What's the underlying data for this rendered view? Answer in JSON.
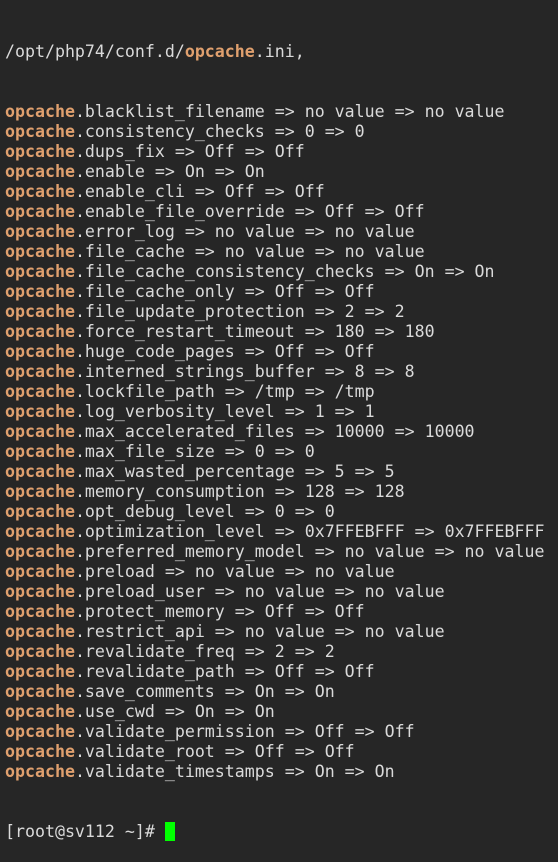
{
  "terminal": {
    "header": {
      "prefix": "/opt/php74/conf.d/",
      "keyword": "opcache",
      "suffix": ".ini,"
    },
    "keyword": "opcache",
    "settings": [
      ".blacklist_filename => no value => no value",
      ".consistency_checks => 0 => 0",
      ".dups_fix => Off => Off",
      ".enable => On => On",
      ".enable_cli => Off => Off",
      ".enable_file_override => Off => Off",
      ".error_log => no value => no value",
      ".file_cache => no value => no value",
      ".file_cache_consistency_checks => On => On",
      ".file_cache_only => Off => Off",
      ".file_update_protection => 2 => 2",
      ".force_restart_timeout => 180 => 180",
      ".huge_code_pages => Off => Off",
      ".interned_strings_buffer => 8 => 8",
      ".lockfile_path => /tmp => /tmp",
      ".log_verbosity_level => 1 => 1",
      ".max_accelerated_files => 10000 => 10000",
      ".max_file_size => 0 => 0",
      ".max_wasted_percentage => 5 => 5",
      ".memory_consumption => 128 => 128",
      ".opt_debug_level => 0 => 0",
      ".optimization_level => 0x7FFEBFFF => 0x7FFEBFFF",
      ".preferred_memory_model => no value => no value",
      ".preload => no value => no value",
      ".preload_user => no value => no value",
      ".protect_memory => Off => Off",
      ".restrict_api => no value => no value",
      ".revalidate_freq => 2 => 2",
      ".revalidate_path => Off => Off",
      ".save_comments => On => On",
      ".use_cwd => On => On",
      ".validate_permission => Off => Off",
      ".validate_root => Off => Off",
      ".validate_timestamps => On => On"
    ],
    "prompt": "[root@sv112 ~]# "
  }
}
